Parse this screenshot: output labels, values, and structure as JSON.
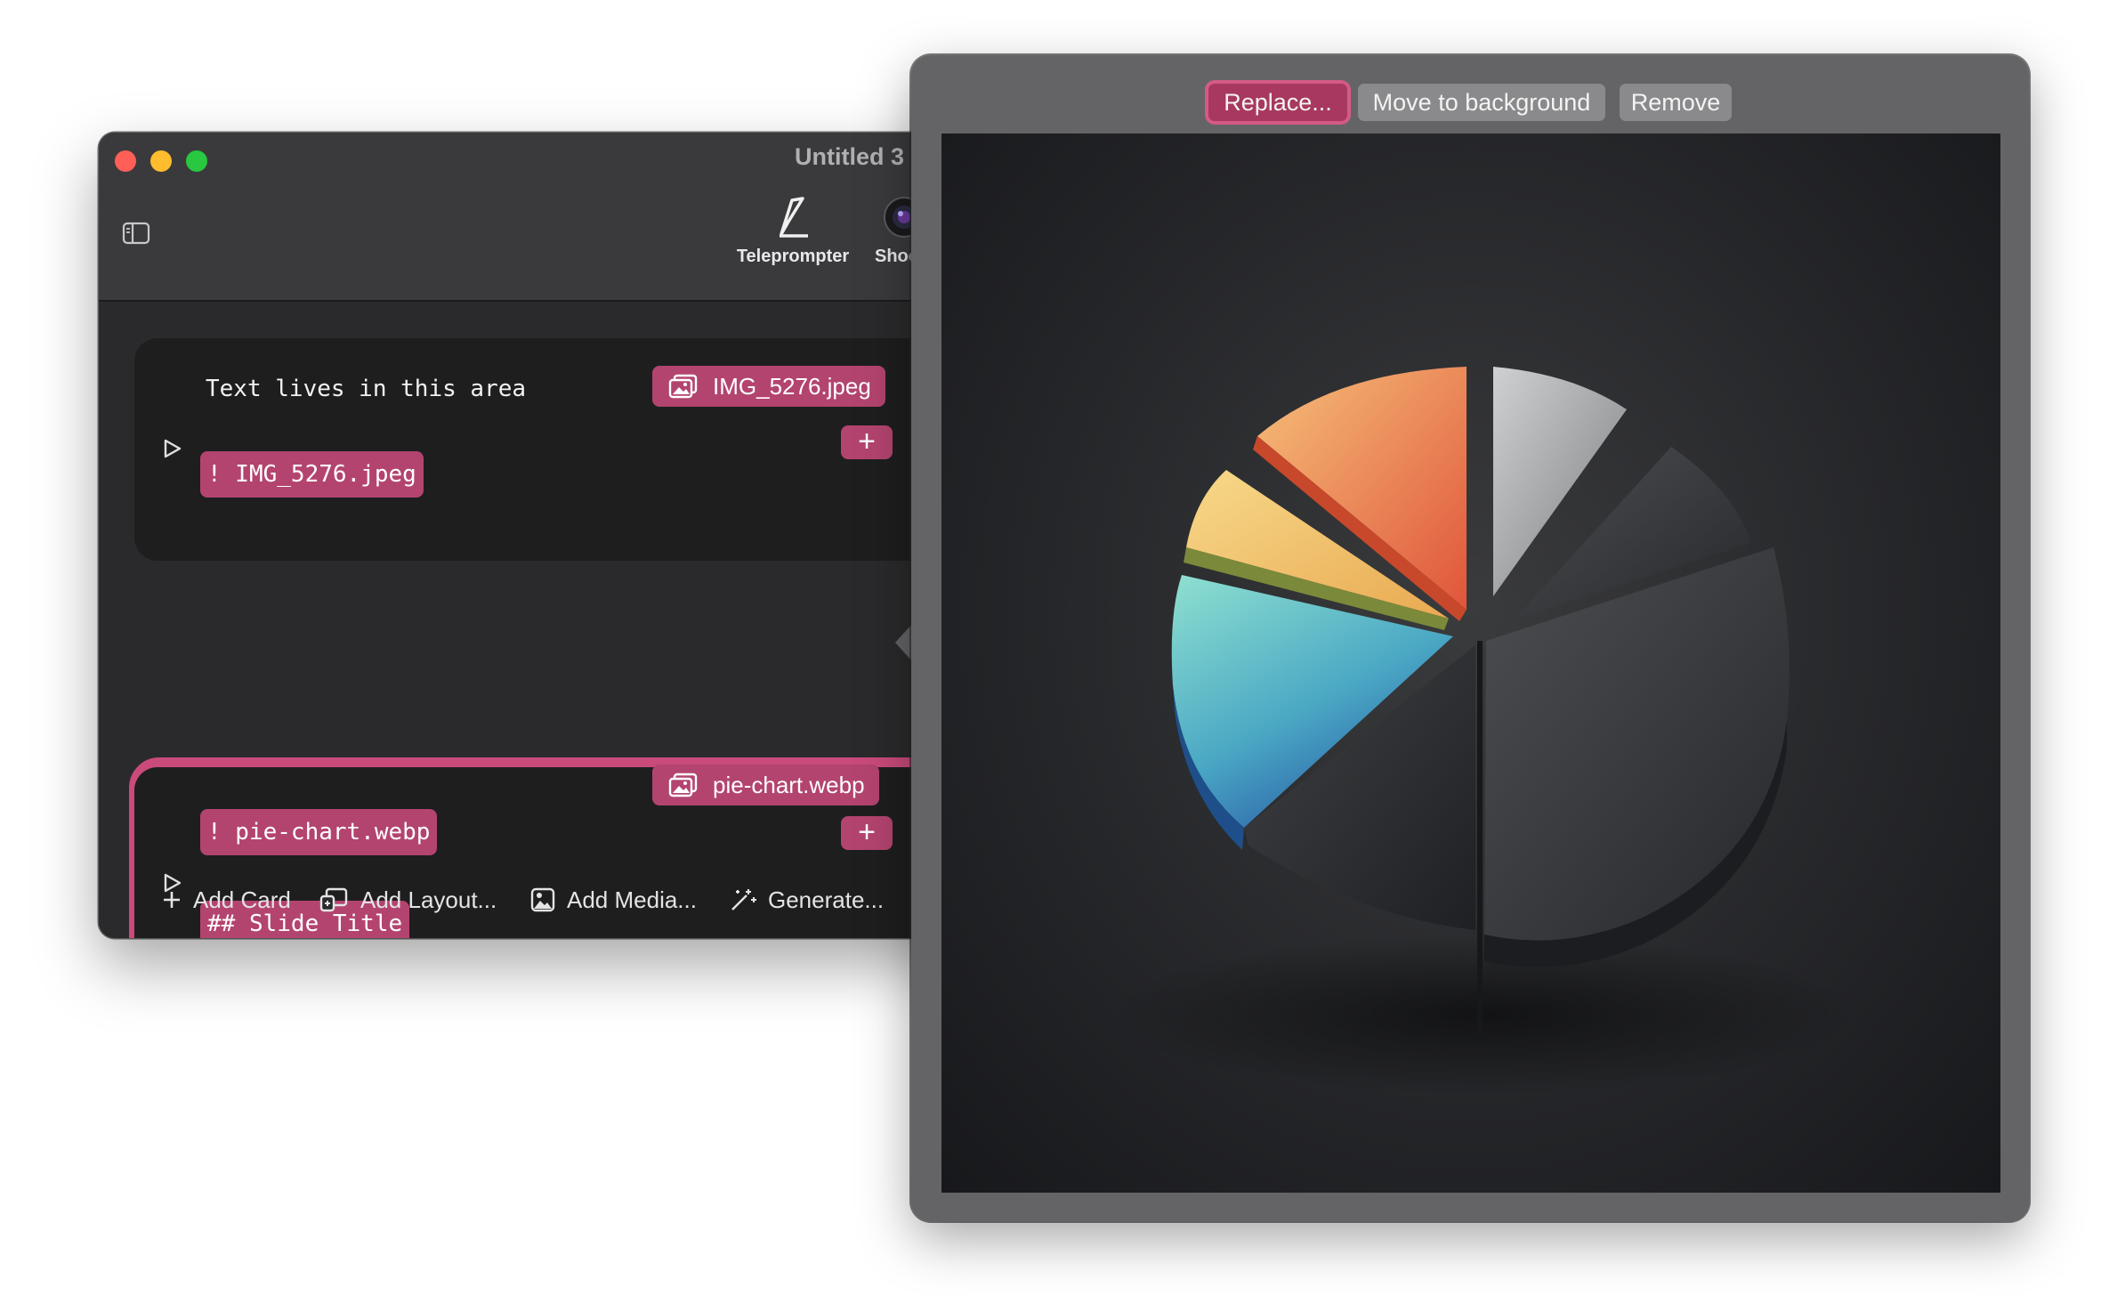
{
  "window": {
    "title": "Untitled 3 -",
    "toolbar": {
      "teleprompter_label": "Teleprompter",
      "shoot_label": "Shoo"
    }
  },
  "cards": [
    {
      "text": "Text lives in this area",
      "media_chip": "! IMG_5276.jpeg",
      "file_label": "IMG_5276.jpeg",
      "add_label": "+"
    },
    {
      "media_chip": "! pie-chart.webp",
      "heading_chip": "## Slide Title",
      "file_label": "pie-chart.webp",
      "add_label": "+",
      "selected": true
    }
  ],
  "bottom_bar": {
    "add_card": "Add Card",
    "add_layout": "Add Layout...",
    "add_media": "Add Media...",
    "generate": "Generate..."
  },
  "popover": {
    "replace_label": "Replace...",
    "move_label": "Move to background",
    "remove_label": "Remove",
    "preview_image": "pie-chart.webp"
  },
  "colors": {
    "accent": "#b3446f",
    "selection_outline": "#c94a7b",
    "card_bg": "#1e1e1e",
    "window_bg": "#2a2a2c",
    "popover_bg": "#646466"
  },
  "icons": [
    "sidebar-toggle-icon",
    "teleprompter-icon",
    "camera-icon",
    "play-icon",
    "image-icon",
    "plus-icon",
    "layout-icon",
    "media-icon",
    "magic-wand-icon"
  ]
}
